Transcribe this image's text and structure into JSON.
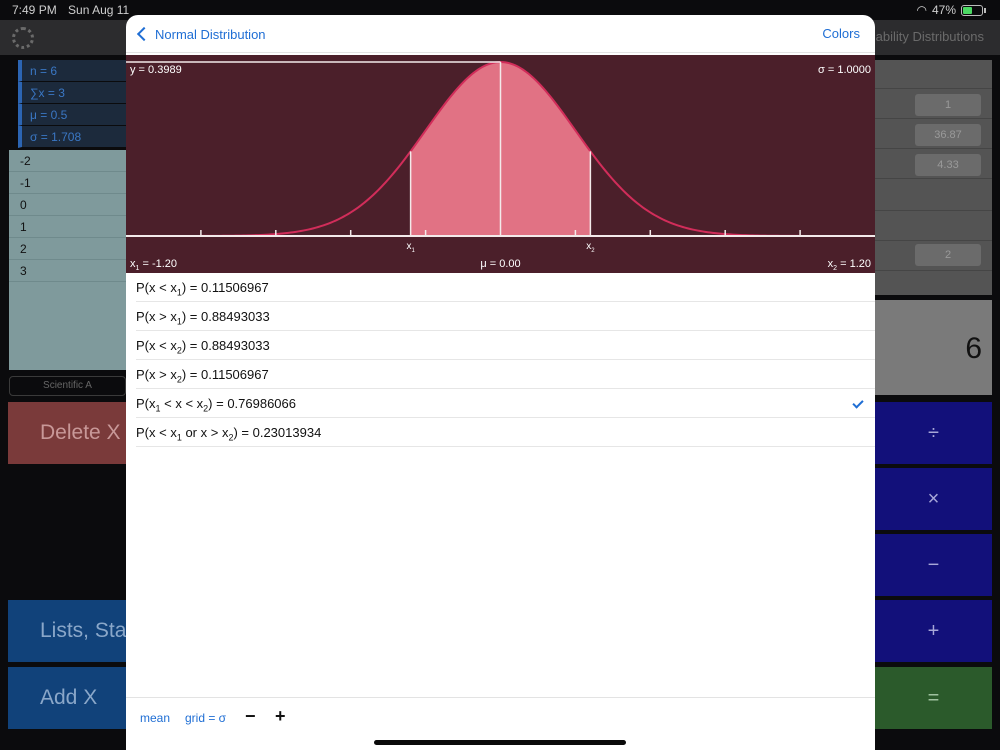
{
  "status_bar": {
    "time": "7:49 PM",
    "date": "Sun Aug 11",
    "battery": "47%"
  },
  "background": {
    "title_right": "ability Distributions",
    "stats": [
      "n = 6",
      "∑x = 3",
      "μ = 0.5",
      "σ = 1.708"
    ],
    "list_values": [
      "-2",
      "-1",
      "0",
      "1",
      "2",
      "3"
    ],
    "mode_label": "Scientific A",
    "delete_label": "Delete X",
    "lists_label": "Lists, Stat",
    "add_label": "Add X",
    "right_fields": [
      "1",
      "36.87",
      "4.33",
      "2"
    ],
    "display_value": "6",
    "ops": [
      "÷",
      "×",
      "−",
      "+",
      "="
    ]
  },
  "modal": {
    "back_label": "Normal Distribution",
    "colors_label": "Colors",
    "chart_labels": {
      "y_peak": "y = 0.3989",
      "sigma": "σ = 1.0000",
      "x1_value": "-1.20",
      "mu": "μ = 0.00",
      "x2_value": "1.20",
      "x1_marker": "x",
      "x2_marker": "x",
      "sub1": "1",
      "sub2": "2"
    },
    "probabilities": [
      {
        "pre": "P(x < x",
        "sub": "1",
        "post": ") = 0.11506967"
      },
      {
        "pre": "P(x > x",
        "sub": "1",
        "post": ") = 0.88493033"
      },
      {
        "pre": "P(x < x",
        "sub": "2",
        "post": ") = 0.88493033"
      },
      {
        "pre": "P(x > x",
        "sub": "2",
        "post": ") = 0.11506967"
      },
      {
        "pre": "P(x",
        "sub": "1",
        "mid": " < x < x",
        "sub2": "2",
        "post": ") = 0.76986066"
      },
      {
        "pre": "P(x < x",
        "sub": "1",
        "mid": " or x > x",
        "sub2": "2",
        "post": ") = 0.23013934"
      }
    ],
    "selected_index": 4,
    "toolbar": {
      "mean_label": "mean",
      "grid_label": "grid = σ",
      "minus_label": "−",
      "plus_label": "+"
    }
  },
  "chart_data": {
    "type": "area",
    "mu": 0,
    "sigma": 1,
    "x1": -1.2,
    "x2": 1.2,
    "xlim": [
      -5,
      5
    ],
    "ylim": [
      0,
      0.3989
    ],
    "ticks": [
      -4,
      -3,
      -2,
      -1,
      1,
      2,
      3,
      4
    ],
    "colors": {
      "background": "#4b1f2a",
      "curve": "#d12d5a",
      "fill": "#e17284",
      "lines": "#f3eaea"
    }
  }
}
